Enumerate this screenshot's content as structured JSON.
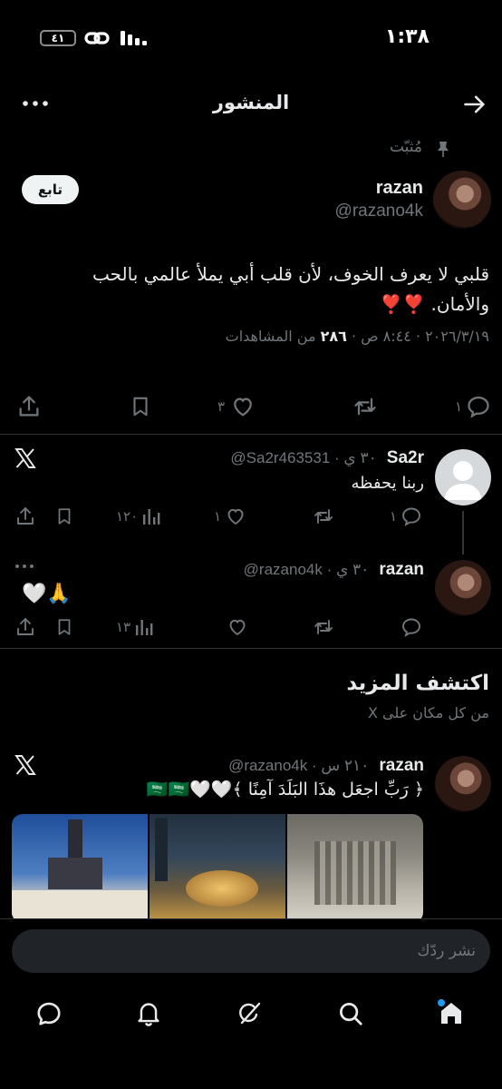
{
  "status_bar": {
    "time": "١:٣٨",
    "battery": "٤١"
  },
  "header": {
    "title": "المنشور"
  },
  "pinned": {
    "label": "مُثبّت"
  },
  "main_post": {
    "name": "razan",
    "handle": "@razano4k",
    "follow_label": "تابع",
    "text_line1": "قلبي لا يعرف الخوف، لأن قلب أبي يملأ عالمي بالحب",
    "text_line2": "والأمان. ❣️❣️",
    "meta_datetime": "٢٠٢٦/٣/١٩ · ٨:٤٤ ص ·",
    "meta_views_count": "٢٨٦",
    "meta_views_label": "من المشاهدات",
    "replies": "١",
    "reposts": "",
    "likes": "٣",
    "bookmarks": ""
  },
  "reply1": {
    "name": "Sa2r",
    "handle_time": "@Sa2r463531 · ٣٠ ي",
    "text": "ربنا يحفظه",
    "replies": "١",
    "reposts": "",
    "likes": "١",
    "views": "١٢٠"
  },
  "reply2": {
    "name": "razan",
    "handle_time": "@razano4k · ٣٠ ي",
    "text": "🤍🙏",
    "replies": "",
    "reposts": "",
    "likes": "",
    "views": "١٣"
  },
  "discover": {
    "title": "اكتشف المزيد",
    "subtitle": "من كل مكان على X"
  },
  "suggested_post": {
    "name": "razan",
    "handle_time": "@razano4k · ٢١٠ س",
    "text": "﴿ رَبِّ اجعَل هذَا البَلَدَ آمِنًا ﴾🤍🤍🇸🇦🇸🇦"
  },
  "composer": {
    "placeholder": "نشر ردّك"
  },
  "bottom_nav": [
    "home-icon",
    "search-icon",
    "grok-icon",
    "notifications-icon",
    "messages-icon"
  ],
  "colors": {
    "background": "#000000",
    "text": "#e7e9ea",
    "muted": "#71767b",
    "accent": "#1d9bf0",
    "divider": "#2f3336"
  }
}
